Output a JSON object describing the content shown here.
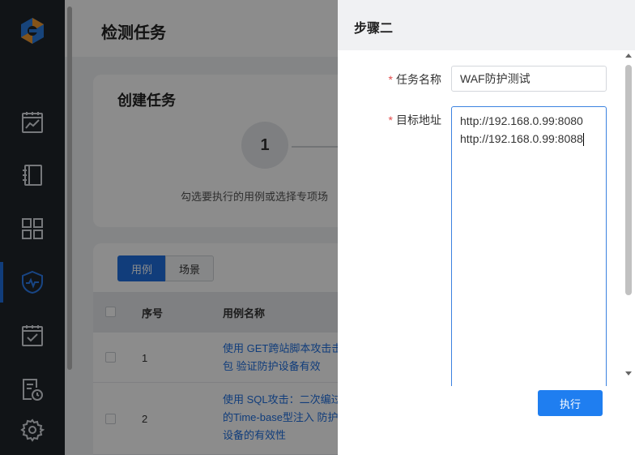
{
  "sidebar": {
    "items": [
      {
        "icon": "dashboard-chart-icon"
      },
      {
        "icon": "notebook-icon"
      },
      {
        "icon": "apps-grid-icon"
      },
      {
        "icon": "shield-pulse-icon",
        "active": true
      },
      {
        "icon": "calendar-check-icon"
      },
      {
        "icon": "report-clock-icon"
      },
      {
        "icon": "gear-icon"
      }
    ],
    "accent": "#1f6fe0"
  },
  "page": {
    "title": "检测任务",
    "create_card": {
      "title": "创建任务",
      "step_number": "1",
      "step_desc": "勾选要执行的用例或选择专项场"
    },
    "tabs": [
      {
        "label": "用例",
        "active": true
      },
      {
        "label": "场景",
        "active": false
      }
    ],
    "table": {
      "columns": [
        "序号",
        "用例名称"
      ],
      "rows": [
        {
          "no": "1",
          "name": "使用 GET跨站脚本攻击击包 验证防护设备有效"
        },
        {
          "no": "2",
          "name": "使用 SQL攻击：二次编过的Time-base型注入 防护设备的有效性"
        }
      ]
    }
  },
  "drawer": {
    "title": "步骤二",
    "fields": {
      "task_name_label": "任务名称",
      "task_name_value": "WAF防护测试",
      "target_label": "目标地址",
      "target_line1": "http://192.168.0.99:8080",
      "target_line2": "http://192.168.0.99:8088"
    },
    "execute_label": "执行",
    "button_color": "#1f7ef0"
  }
}
